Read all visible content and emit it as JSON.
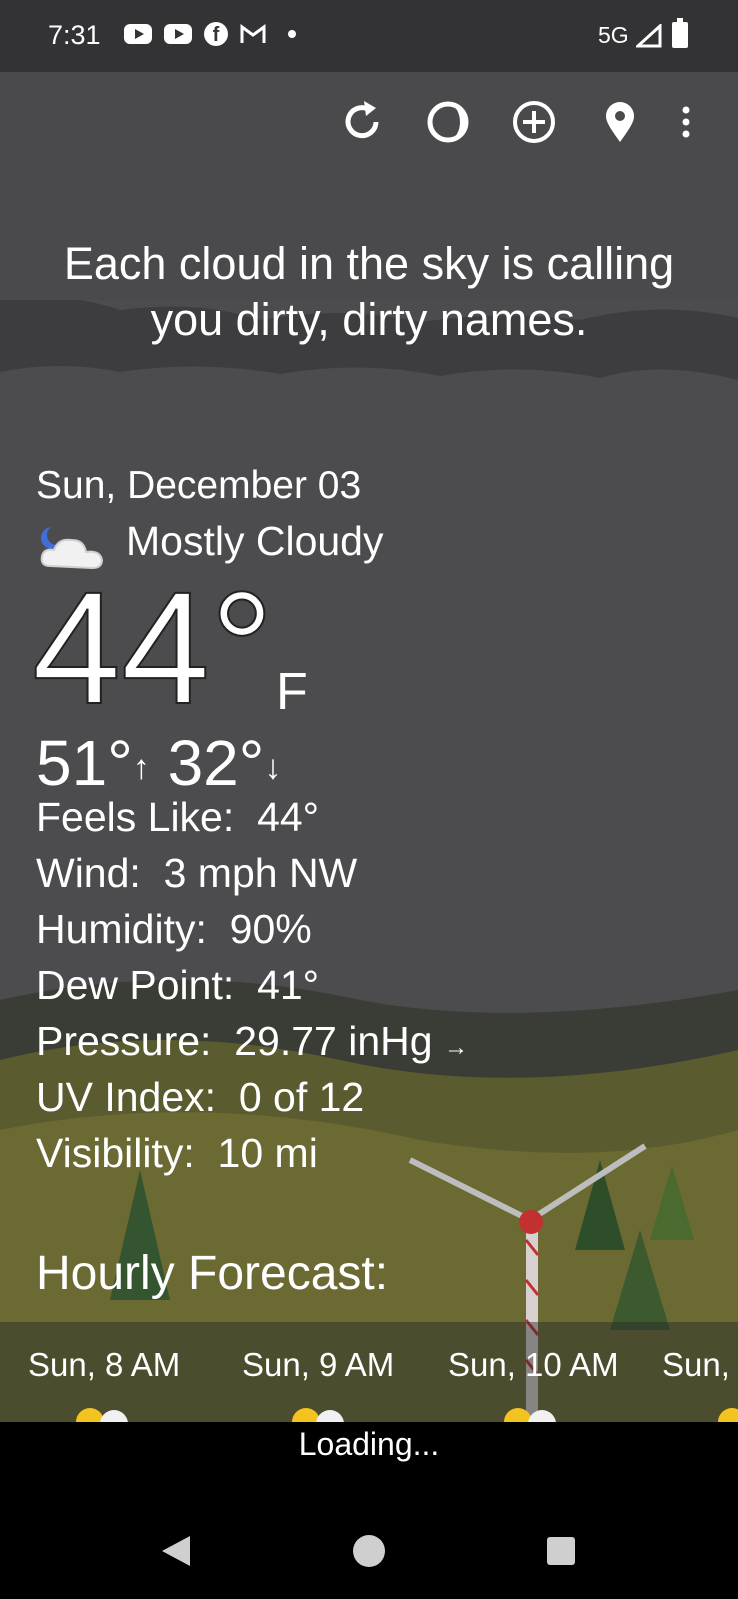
{
  "status": {
    "time": "7:31",
    "network": "5G"
  },
  "quote": "Each cloud in the sky is calling you dirty, dirty names.",
  "current": {
    "date": "Sun, December 03",
    "condition": "Mostly Cloudy",
    "temp": "44°",
    "unit": "F",
    "high": "51°",
    "low": "32°",
    "details": [
      {
        "label": "Feels Like:",
        "value": "44°"
      },
      {
        "label": "Wind:",
        "value": "3 mph NW"
      },
      {
        "label": "Humidity:",
        "value": "90%"
      },
      {
        "label": "Dew Point:",
        "value": "41°"
      },
      {
        "label": "Pressure:",
        "value": "29.77 inHg"
      },
      {
        "label": "UV Index:",
        "value": "0 of 12"
      },
      {
        "label": "Visibility:",
        "value": "10 mi"
      }
    ]
  },
  "hourly": {
    "title": "Hourly Forecast:",
    "hours": [
      "Sun, 8 AM",
      "Sun, 9 AM",
      "Sun, 10 AM",
      "Sun,"
    ]
  },
  "footer": {
    "loading": "Loading..."
  },
  "icons": [
    "refresh-icon",
    "moon-phase-icon",
    "add-location-icon",
    "location-pin-icon",
    "more-vert-icon",
    "back-icon",
    "home-icon",
    "recents-icon"
  ]
}
